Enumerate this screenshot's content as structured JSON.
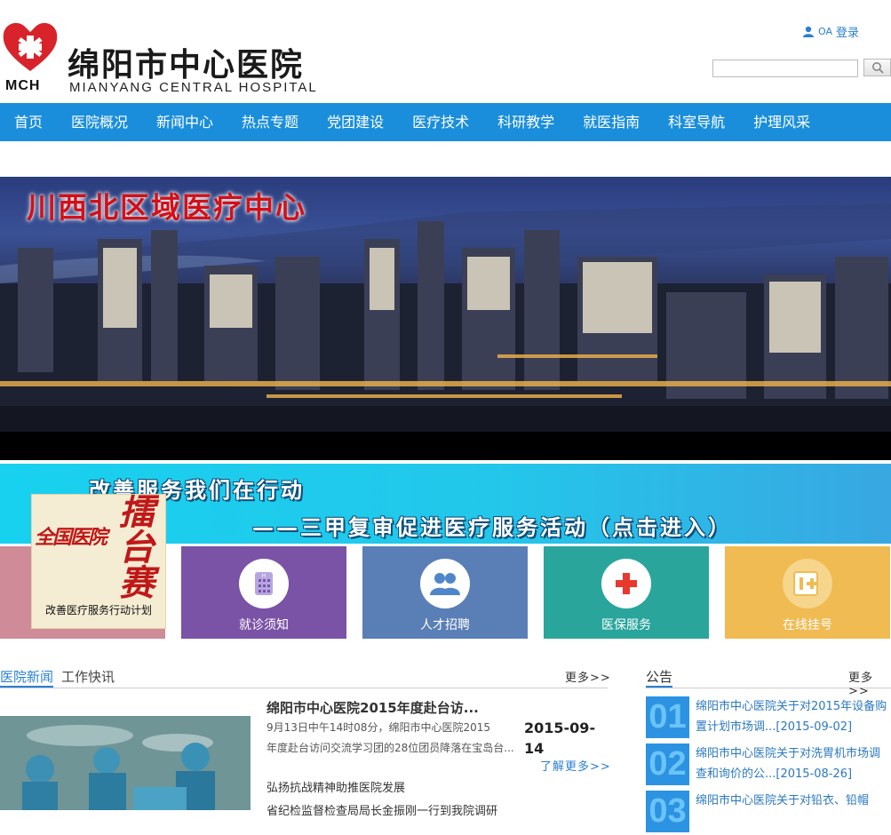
{
  "header": {
    "logo_cn": "绵阳市中心医院",
    "logo_en": "MIANYANG CENTRAL HOSPITAL",
    "logo_abbr": "MCH",
    "oa_label": "OA",
    "login_label": "登录",
    "search_value": ""
  },
  "nav": {
    "items": [
      "首页",
      "医院概况",
      "新闻中心",
      "热点专题",
      "党团建设",
      "医疗技术",
      "科研教学",
      "就医指南",
      "科室导航",
      "护理风采"
    ]
  },
  "banner": {
    "title": "川西北区域医疗中心"
  },
  "promo": {
    "line1": "改善服务我们在行动",
    "line2": "——三甲复审促进医疗服务活动（点击进入）"
  },
  "float_ad": {
    "left_text": "全国医院",
    "right_text": "擂台赛",
    "caption": "改善医疗服务行动计划"
  },
  "tiles": [
    {
      "label": "",
      "icon": "hospital-icon",
      "color": "#cf8b97"
    },
    {
      "label": "就诊须知",
      "icon": "hospital-building-icon",
      "color": "#7a52a6"
    },
    {
      "label": "人才招聘",
      "icon": "people-icon",
      "color": "#5a7fb7"
    },
    {
      "label": "医保服务",
      "icon": "medical-cross-icon",
      "color": "#2aa59c"
    },
    {
      "label": "在线挂号",
      "icon": "register-card-icon",
      "color": "#f0bb52"
    }
  ],
  "news": {
    "tabs": [
      "医院新闻",
      "工作快讯"
    ],
    "more": "更多>>",
    "headline": "绵阳市中心医院2015年度赴台访...",
    "summary_line1": "9月13日中午14时08分，绵阳市中心医院2015",
    "date": "2015-09-14",
    "summary_line2": "年度赴台访问交流学习团的28位团员降落在宝岛台...",
    "read_more": "了解更多>>",
    "links": [
      "弘扬抗战精神助推医院发展",
      "省纪检监督检查局局长金振刚一行到我院调研"
    ]
  },
  "notices": {
    "title": "公告",
    "more": "更多>>",
    "items": [
      {
        "num": "01",
        "text": "绵阳市中心医院关于对2015年设备购置计划市场调...[2015-09-02]"
      },
      {
        "num": "02",
        "text": "绵阳市中心医院关于对洗胃机市场调查和询价的公...[2015-08-26]"
      },
      {
        "num": "03",
        "text": "绵阳市中心医院关于对铅衣、铅帽"
      }
    ]
  },
  "colors": {
    "nav_bg": "#1a8edb",
    "accent_blue": "#2a7fd1",
    "brand_red": "#d8232a"
  }
}
